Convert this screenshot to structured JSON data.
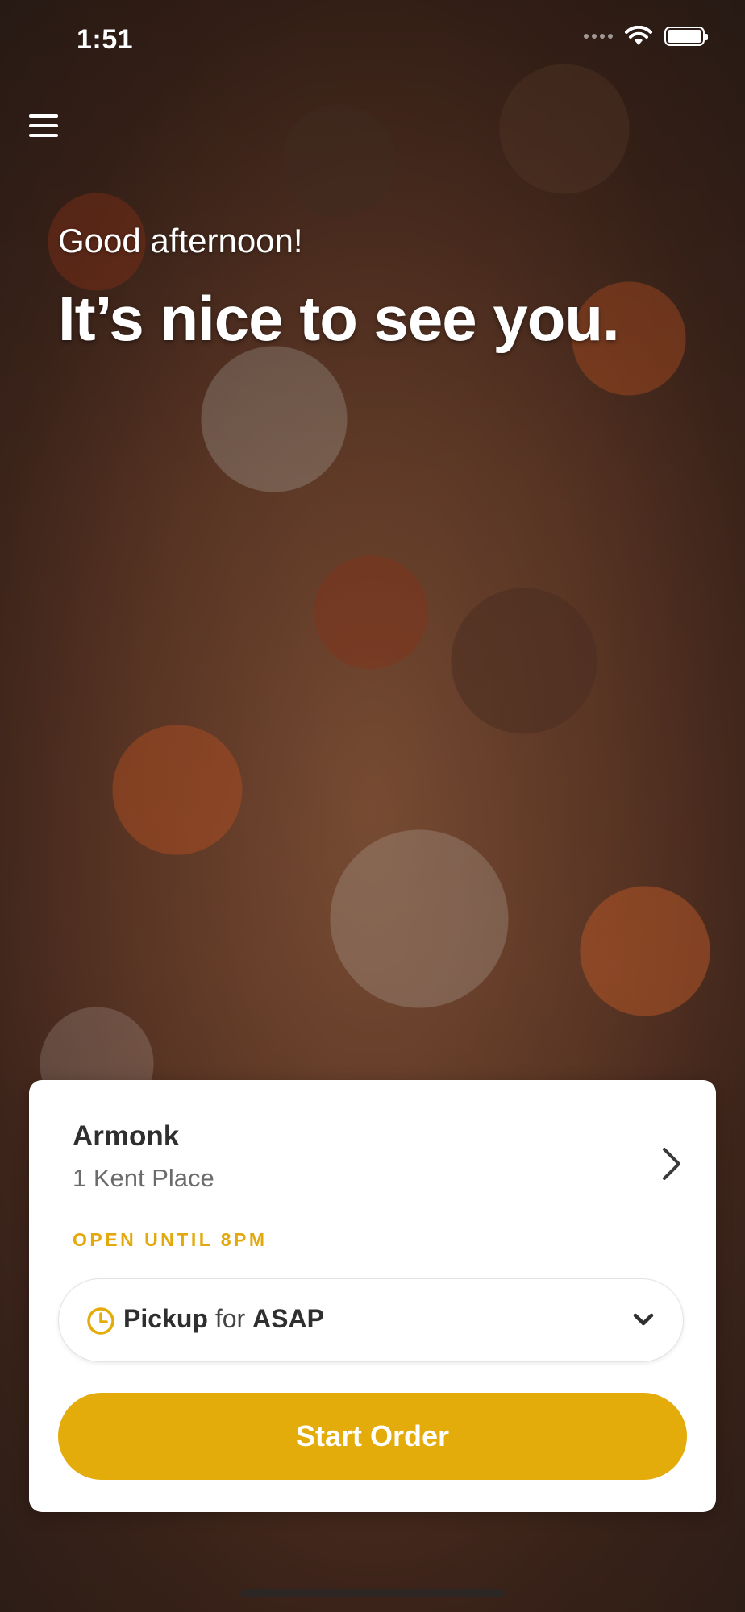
{
  "status_bar": {
    "time": "1:51"
  },
  "header": {
    "menu_icon": "hamburger-menu-icon"
  },
  "hero": {
    "greeting": "Good afternoon!",
    "headline": "It’s nice to see you."
  },
  "store": {
    "name": "Armonk",
    "address": "1 Kent Place",
    "open_status": "OPEN UNTIL 8PM"
  },
  "order_mode": {
    "mode": "Pickup",
    "connector": "for",
    "time": "ASAP"
  },
  "actions": {
    "start_order": "Start Order"
  },
  "colors": {
    "accent": "#e4ac0a",
    "open_status": "#e3a90c",
    "card_bg": "#ffffff",
    "text_dark": "#2f2f2f",
    "text_muted": "#6b6b6b"
  }
}
